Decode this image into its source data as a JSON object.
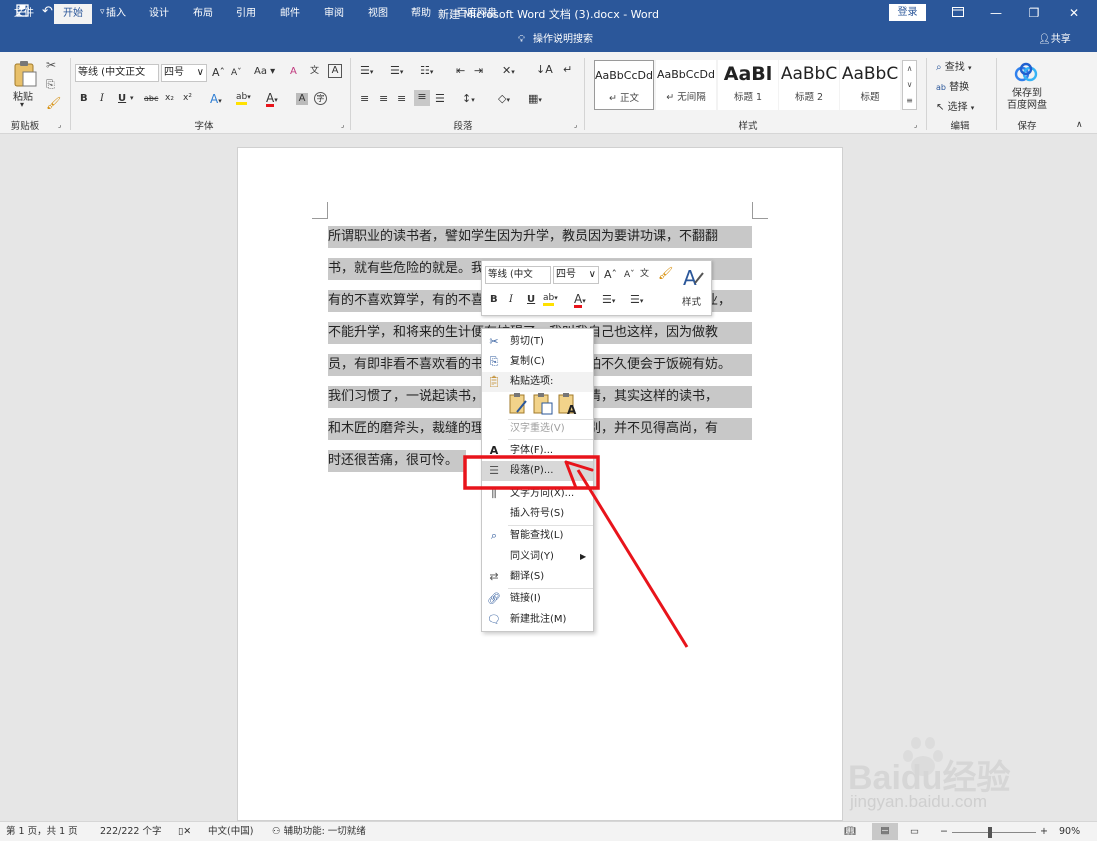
{
  "titlebar": {
    "title": "新建 Microsoft Word 文档 (3).docx  -  Word",
    "login_label": "登录"
  },
  "tabs": [
    "文件",
    "开始",
    "插入",
    "设计",
    "布局",
    "引用",
    "邮件",
    "审阅",
    "视图",
    "帮助",
    "百度网盘"
  ],
  "active_tab": "开始",
  "tell_me": "操作说明搜索",
  "share": "共享",
  "ribbon": {
    "clipboard": {
      "paste": "粘贴",
      "label": "剪贴板"
    },
    "font": {
      "font_name": "等线 (中文正文",
      "font_size": "四号",
      "label": "字体",
      "bold": "B",
      "italic": "I",
      "underline": "U",
      "strike": "abc",
      "sub": "x₂",
      "sup": "x²",
      "grow": "A",
      "shrink": "A",
      "case": "Aa",
      "clear": "A",
      "phonetic": "文",
      "border": "A"
    },
    "paragraph": {
      "label": "段落"
    },
    "styles": {
      "label": "样式",
      "items": [
        {
          "preview": "AaBbCcDd",
          "name": "↵ 正文"
        },
        {
          "preview": "AaBbCcDd",
          "name": "↵ 无间隔"
        },
        {
          "preview": "AaBl",
          "name": "标题 1"
        },
        {
          "preview": "AaBbC",
          "name": "标题 2"
        },
        {
          "preview": "AaBbC",
          "name": "标题"
        }
      ]
    },
    "editing": {
      "label": "编辑",
      "find": "查找",
      "replace": "替换",
      "select": "选择"
    },
    "save": {
      "label": "保存",
      "button": "保存到\n百度网盘"
    }
  },
  "document": {
    "lines": [
      "所谓职业的读书者，譬如学生因为升学，教员因为要讲功课，不翻翻",
      "书，就有些危险的就是。我想在坐的诸君之中一定有些这样的经验，",
      "有的不喜欢算学，有的不喜欢博物，然而不得不学，否则，不能毕业，",
      "不能升学，和将来的生计便有妨碍了。我叫我自己也这样，因为做教",
      "员，有即非看不喜欢看的书不可，要不这样，怕不久便会于饭碗有妨。",
      "我们习惯了，一说起读书，就觉得是高尚的事情，其实这样的读书，",
      "和木匠的磨斧头，裁缝的理针线并没有什么分别，并不见得高尚，有",
      "时还很苦痛，很可怜。"
    ]
  },
  "minitoolbar": {
    "font_name": "等线 (中文",
    "font_size": "四号",
    "styles_label": "样式"
  },
  "context_menu": {
    "items": [
      {
        "icon": "scissors-icon",
        "label": "剪切(T)",
        "disabled": false
      },
      {
        "icon": "copy-icon",
        "label": "复制(C)",
        "disabled": false
      },
      {
        "icon": "paste-icon",
        "label": "粘贴选项:",
        "disabled": false
      },
      {
        "icon": "",
        "label": "汉字重选(V)",
        "disabled": true
      },
      {
        "icon": "font-icon",
        "label": "字体(F)...",
        "disabled": false
      },
      {
        "icon": "paragraph-icon",
        "label": "段落(P)...",
        "disabled": false
      },
      {
        "icon": "text-direction-icon",
        "label": "文字方向(X)...",
        "disabled": false
      },
      {
        "icon": "",
        "label": "插入符号(S)",
        "disabled": false
      },
      {
        "icon": "smart-lookup-icon",
        "label": "智能查找(L)",
        "disabled": false
      },
      {
        "icon": "",
        "label": "同义词(Y)",
        "disabled": false
      },
      {
        "icon": "translate-icon",
        "label": "翻译(S)",
        "disabled": false
      },
      {
        "icon": "link-icon",
        "label": "链接(I)",
        "disabled": false
      },
      {
        "icon": "new-comment-icon",
        "label": "新建批注(M)",
        "disabled": false
      }
    ],
    "highlighted": "段落(P)..."
  },
  "statusbar": {
    "page": "第 1 页，共 1 页",
    "words": "222/222 个字",
    "language": "中文(中国)",
    "accessibility": "辅助功能: 一切就绪",
    "zoom": "90%",
    "zoom_level": 0.45
  },
  "annotation": {
    "color": "#e8141b"
  },
  "watermark": {
    "brand": "Baidu经验",
    "url": "jingyan.baidu.com"
  },
  "colors": {
    "accent": "#2b579a",
    "selection": "#c8c8c8"
  }
}
